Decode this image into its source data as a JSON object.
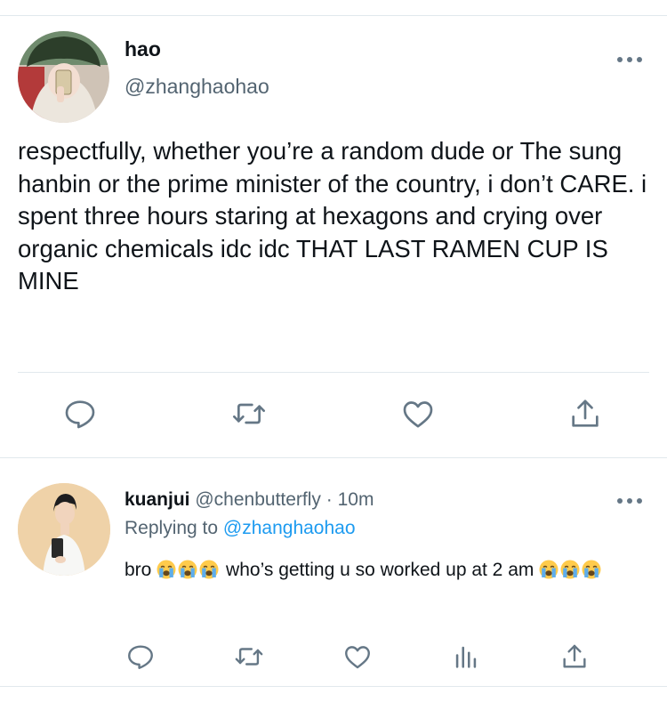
{
  "main_tweet": {
    "display_name": "hao",
    "handle": "@zhanghaohao",
    "text": "respectfully, whether you’re a random dude or The sung hanbin or the prime minister of the country, i don’t CARE. i spent three hours staring at hexagons and crying over organic chemicals idc idc THAT LAST RAMEN CUP IS MINE",
    "more_icon": "more-horizontal-icon",
    "actions": [
      "reply-icon",
      "retweet-icon",
      "like-icon",
      "share-icon"
    ]
  },
  "reply": {
    "display_name": "kuanjui",
    "handle": "@chenbutterfly",
    "separator": " · ",
    "time": "10m",
    "replying_label": "Replying to",
    "replying_to": "@zhanghaohao",
    "text_before": "bro",
    "text_middle": "who’s getting u so worked up at 2 am",
    "emoji_name": "loudly-crying-face",
    "emoji_groups": [
      3,
      3
    ],
    "actions": [
      "reply-icon",
      "retweet-icon",
      "like-icon",
      "analytics-icon",
      "share-icon"
    ]
  },
  "colors": {
    "text": "#0f1419",
    "secondary": "#536471",
    "icon": "#657786",
    "link": "#1d9bf0",
    "divider": "#e1e8ed"
  }
}
